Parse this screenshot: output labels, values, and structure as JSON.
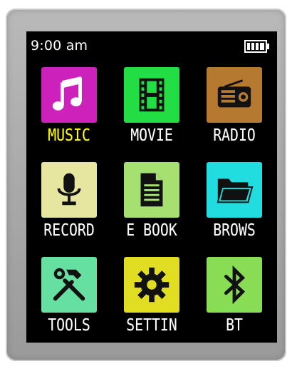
{
  "status_bar": {
    "time": "9:00 am",
    "battery_icon": "battery-full-icon"
  },
  "colors": {
    "screen_background": "#000000",
    "label_default": "#ffffff",
    "label_selected": "#ffff00",
    "icon_glyph": "#111111"
  },
  "apps": [
    {
      "label": "MUSIC",
      "icon": "music-note-icon",
      "tile_color": "#cc22bb",
      "selected": true,
      "glyph_color": "#ffffff"
    },
    {
      "label": "MOVIE",
      "icon": "film-strip-icon",
      "tile_color": "#22dd44",
      "selected": false,
      "glyph_color": "#111111"
    },
    {
      "label": "RADIO",
      "icon": "radio-icon",
      "tile_color": "#b57a30",
      "selected": false,
      "glyph_color": "#111111"
    },
    {
      "label": "RECORD",
      "icon": "microphone-icon",
      "tile_color": "#e6e6a0",
      "selected": false,
      "glyph_color": "#111111"
    },
    {
      "label": "E BOOK",
      "icon": "document-icon",
      "tile_color": "#a6e070",
      "selected": false,
      "glyph_color": "#111111"
    },
    {
      "label": "BROWS",
      "icon": "folder-icon",
      "tile_color": "#22dde0",
      "selected": false,
      "glyph_color": "#111111"
    },
    {
      "label": "TOOLS",
      "icon": "tools-icon",
      "tile_color": "#66e0a0",
      "selected": false,
      "glyph_color": "#111111"
    },
    {
      "label": "SETTIN",
      "icon": "gear-icon",
      "tile_color": "#e0dd22",
      "selected": false,
      "glyph_color": "#111111"
    },
    {
      "label": "BT",
      "icon": "bluetooth-icon",
      "tile_color": "#88dd55",
      "selected": false,
      "glyph_color": "#111111"
    }
  ]
}
